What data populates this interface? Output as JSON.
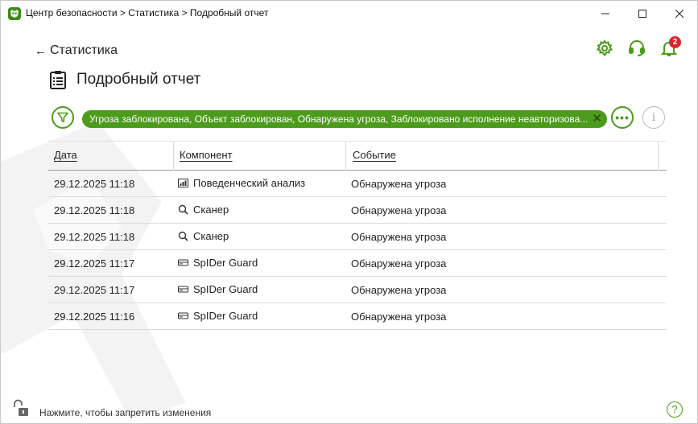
{
  "window": {
    "title": "Центр безопасности > Статистика > Подробный отчет",
    "controls": {
      "minimize": "minimize-icon",
      "maximize": "maximize-icon",
      "close": "close-icon"
    }
  },
  "header": {
    "back_label": "Статистика",
    "page_title": "Подробный отчет",
    "notifications_count": "2"
  },
  "filter": {
    "chip_text": "Угроза заблокирована, Объект заблокирован, Обнаружена угроза, Заблокировано исполнение неавторизова...",
    "chip_close": "✕",
    "more_label": "•••",
    "info_label": "i"
  },
  "table": {
    "columns": [
      "Дата",
      "Компонент",
      "Событие"
    ],
    "rows": [
      {
        "date": "29.12.2025 11:18",
        "component": "Поведенческий анализ",
        "icon": "behavior-icon",
        "event": "Обнаружена угроза"
      },
      {
        "date": "29.12.2025 11:18",
        "component": "Сканер",
        "icon": "search-icon",
        "event": "Обнаружена угроза"
      },
      {
        "date": "29.12.2025 11:18",
        "component": "Сканер",
        "icon": "search-icon",
        "event": "Обнаружена угроза"
      },
      {
        "date": "29.12.2025 11:17",
        "component": "SpIDer Guard",
        "icon": "drive-icon",
        "event": "Обнаружена угроза"
      },
      {
        "date": "29.12.2025 11:17",
        "component": "SpIDer Guard",
        "icon": "drive-icon",
        "event": "Обнаружена угроза"
      },
      {
        "date": "29.12.2025 11:16",
        "component": "SpIDer Guard",
        "icon": "drive-icon",
        "event": "Обнаружена угроза"
      }
    ]
  },
  "footer": {
    "lock_text": "Нажмите, чтобы запретить изменения",
    "help_label": "?"
  },
  "colors": {
    "accent": "#4d9b1c",
    "badge": "#e0252a"
  }
}
